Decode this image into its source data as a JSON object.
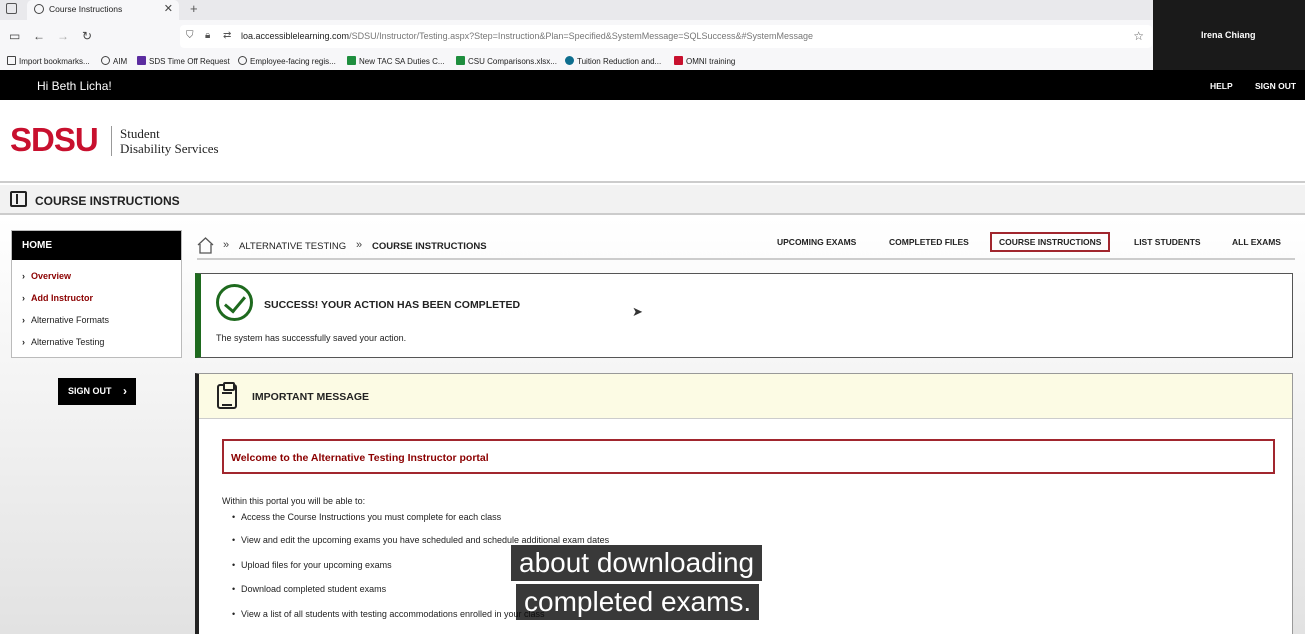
{
  "browser": {
    "tab_title": "Course Instructions",
    "close_glyph": "✕",
    "newtab_glyph": "+",
    "url_domain": "loa.accessiblelearning.com",
    "url_path": "/SDSU/Instructor/Testing.aspx?Step=Instruction&Plan=Specified&SystemMessage=SQLSuccess&#SystemMessage",
    "bookmarks": [
      {
        "label": "Import bookmarks...",
        "color": "#444"
      },
      {
        "label": "AIM",
        "color": "#444"
      },
      {
        "label": "SDS Time Off Request",
        "color": "#5b2ca0"
      },
      {
        "label": "Employee-facing regis...",
        "color": "#444"
      },
      {
        "label": "New TAC SA Duties C...",
        "color": "#1e8e3e"
      },
      {
        "label": "CSU Comparisons.xlsx...",
        "color": "#1e8e3e"
      },
      {
        "label": "Tuition Reduction and...",
        "color": "#0e6e8e"
      },
      {
        "label": "OMNI training",
        "color": "#c8102e"
      }
    ]
  },
  "webcam": {
    "name": "Irena Chiang"
  },
  "header": {
    "greeting": "Hi Beth Licha!",
    "help": "HELP",
    "signout": "SIGN OUT",
    "logo": "SDSU",
    "logo_sub_1": "Student",
    "logo_sub_2": "Disability Services",
    "page_title": "COURSE INSTRUCTIONS"
  },
  "sidebar": {
    "home": "HOME",
    "items": [
      {
        "label": "Overview"
      },
      {
        "label": "Add Instructor"
      },
      {
        "label": "Alternative Formats"
      },
      {
        "label": "Alternative Testing"
      }
    ],
    "signout": "SIGN OUT"
  },
  "breadcrumb": {
    "level1": "ALTERNATIVE TESTING",
    "level2": "COURSE INSTRUCTIONS",
    "sep": "»"
  },
  "tabs": [
    {
      "label": "UPCOMING EXAMS"
    },
    {
      "label": "COMPLETED FILES"
    },
    {
      "label": "COURSE INSTRUCTIONS"
    },
    {
      "label": "LIST STUDENTS"
    },
    {
      "label": "ALL EXAMS"
    }
  ],
  "success": {
    "heading": "SUCCESS! YOUR ACTION HAS BEEN COMPLETED",
    "text": "The system has successfully saved your action."
  },
  "message": {
    "title": "IMPORTANT MESSAGE",
    "welcome": "Welcome to the Alternative Testing Instructor portal",
    "intro": "Within this portal you will be able to:",
    "bullets": [
      "Access the Course Instructions you must complete for each class",
      "View and edit the upcoming exams you have scheduled and schedule additional exam dates",
      "Upload files for your upcoming exams",
      "Download completed student exams",
      "View a list of all students with testing accommodations enrolled in your class"
    ]
  },
  "captions": {
    "line1": "about downloading",
    "line2": "completed exams."
  }
}
